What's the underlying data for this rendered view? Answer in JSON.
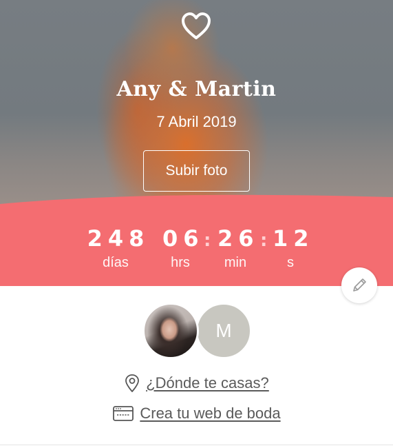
{
  "header": {
    "icon": "heart-icon",
    "couple_names": "Any & Martin",
    "date": "7 Abril 2019",
    "upload_button_label": "Subir foto"
  },
  "countdown": {
    "units": [
      {
        "value": "248",
        "label": "días"
      },
      {
        "value": "06",
        "label": "hrs"
      },
      {
        "value": "26",
        "label": "min"
      },
      {
        "value": "12",
        "label": "s"
      }
    ],
    "separator": ":"
  },
  "edit": {
    "icon": "pencil-icon"
  },
  "avatars": {
    "partner_initial": "M"
  },
  "links": {
    "location": {
      "icon": "location-pin-icon",
      "label": "¿Dónde te casas?"
    },
    "website": {
      "icon": "browser-window-icon",
      "label": "Crea tu web de boda"
    }
  },
  "colors": {
    "accent": "#f46d71",
    "avatar_placeholder": "#c8c7c0",
    "link_text": "#5a5a5a"
  }
}
